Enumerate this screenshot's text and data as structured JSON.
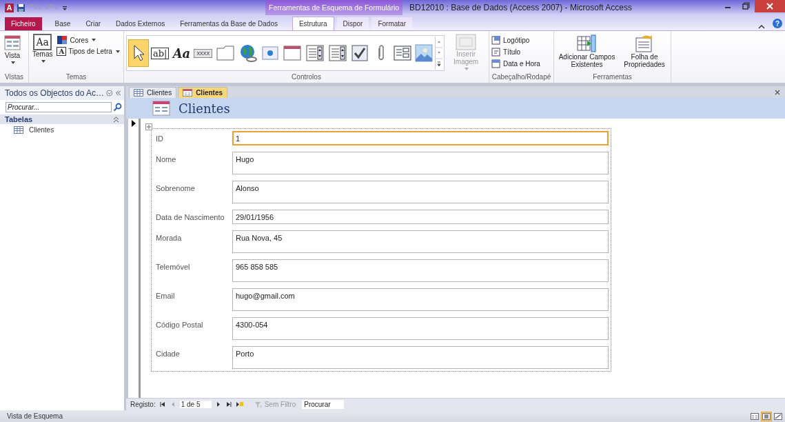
{
  "window": {
    "logo_glyph": "A",
    "context_group": "Ferramentas de Esquema de Formulário",
    "title": "BD12010 : Base de Dados (Access 2007)  -  Microsoft Access",
    "help_glyph": "?"
  },
  "ribbon_tabs": [
    {
      "label": "Ficheiro",
      "kind": "file",
      "selected": false
    },
    {
      "label": "Base",
      "kind": "tab",
      "selected": false
    },
    {
      "label": "Criar",
      "kind": "tab",
      "selected": false
    },
    {
      "label": "Dados Externos",
      "kind": "tab",
      "selected": false
    },
    {
      "label": "Ferramentas da Base de Dados",
      "kind": "tab",
      "selected": false
    },
    {
      "label": "Estrutura",
      "kind": "context",
      "selected": true
    },
    {
      "label": "Dispor",
      "kind": "context",
      "selected": false
    },
    {
      "label": "Formatar",
      "kind": "context",
      "selected": false
    }
  ],
  "ribbon_groups": [
    {
      "kind": "views",
      "label": "Vistas",
      "button": "Vista"
    },
    {
      "kind": "themes",
      "label": "Temas",
      "button": "Temas",
      "button_glyph": "Aa",
      "small": [
        {
          "label": "Cores",
          "kind": "colors"
        },
        {
          "label": "Tipos de Letra",
          "kind": "font",
          "glyph": "A"
        }
      ]
    },
    {
      "kind": "controls",
      "label": "Controlos",
      "gallery": [
        {
          "kind": "select",
          "selected": true
        },
        {
          "kind": "textbox",
          "glyph": "ab|",
          "selected": false
        },
        {
          "kind": "label",
          "glyph": "Aa",
          "selected": false
        },
        {
          "kind": "button",
          "glyph": "XXXX",
          "selected": false
        },
        {
          "kind": "tab",
          "selected": false
        },
        {
          "kind": "globe",
          "selected": false
        },
        {
          "kind": "browser",
          "selected": false
        },
        {
          "kind": "navigation",
          "selected": false
        },
        {
          "kind": "combo",
          "selected": false
        },
        {
          "kind": "list",
          "selected": false
        },
        {
          "kind": "check",
          "selected": false
        },
        {
          "kind": "clip",
          "selected": false
        },
        {
          "kind": "group",
          "selected": false
        },
        {
          "kind": "image",
          "selected": false
        }
      ],
      "extra": {
        "label": "Inserir Imagem",
        "disabled": true
      }
    },
    {
      "kind": "header",
      "label": "Cabeçalho/Rodapé",
      "small": [
        {
          "label": "Logótipo",
          "kind": "logo"
        },
        {
          "label": "Título",
          "kind": "title"
        },
        {
          "label": "Data e Hora",
          "kind": "date"
        }
      ]
    },
    {
      "kind": "tools",
      "label": "Ferramentas",
      "large": [
        {
          "label": "Adicionar Campos Existentes",
          "kind": "fields"
        },
        {
          "label": "Folha de Propriedades",
          "kind": "sheet"
        }
      ]
    }
  ],
  "nav_pane": {
    "title": "Todos os Objectos do Ac…",
    "search_placeholder": "Procurar...",
    "groups": [
      {
        "label": "Tabelas",
        "expanded": true,
        "items": [
          {
            "label": "Clientes",
            "selected": false
          }
        ]
      }
    ]
  },
  "doc_tabs": [
    {
      "label": "Clientes",
      "kind": "table",
      "selected": false
    },
    {
      "label": "Clientes",
      "kind": "form",
      "selected": true
    }
  ],
  "form": {
    "title": "Clientes",
    "fields": [
      {
        "label": "ID",
        "value": "1",
        "multiline": false,
        "selected": true
      },
      {
        "label": "Nome",
        "value": "Hugo",
        "multiline": true,
        "selected": false
      },
      {
        "label": "Sobrenome",
        "value": "Alonso",
        "multiline": true,
        "selected": false
      },
      {
        "label": "Data de Nascimento",
        "value": "29/01/1956",
        "multiline": false,
        "selected": false
      },
      {
        "label": "Morada",
        "value": "Rua Nova, 45",
        "multiline": true,
        "selected": false
      },
      {
        "label": "Telemóvel",
        "value": "965 858 585",
        "multiline": true,
        "selected": false
      },
      {
        "label": "Email",
        "value": "hugo@gmail.com",
        "multiline": true,
        "selected": false
      },
      {
        "label": "Código Postal",
        "value": "4300-054",
        "multiline": true,
        "selected": false
      },
      {
        "label": "Cidade",
        "value": "Porto",
        "multiline": true,
        "selected": false
      }
    ]
  },
  "record_nav": {
    "label": "Registo:",
    "position": "1 de 5",
    "filter": "Sem Filtro",
    "search_placeholder": "Procurar"
  },
  "status_bar": {
    "text": "Vista de Esquema",
    "views": [
      {
        "kind": "form",
        "selected": false
      },
      {
        "kind": "layout",
        "selected": true
      },
      {
        "kind": "design",
        "selected": false
      }
    ]
  }
}
